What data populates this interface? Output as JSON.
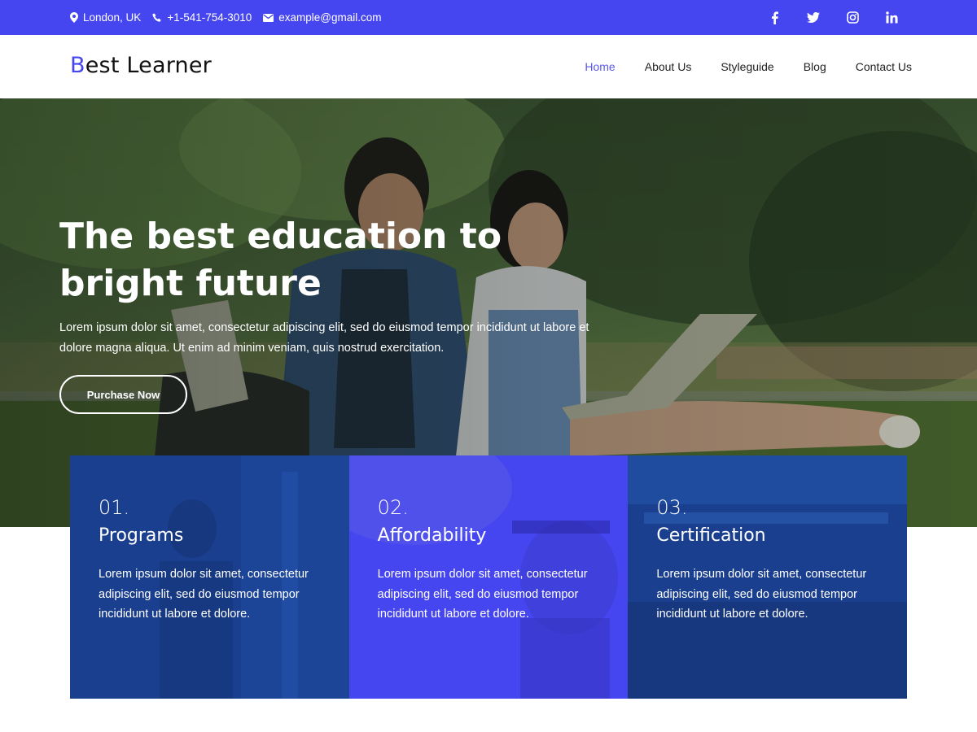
{
  "topbar": {
    "location": "London, UK",
    "phone": "+1-541-754-3010",
    "email": "example@gmail.com",
    "social": [
      "facebook-icon",
      "twitter-icon",
      "instagram-icon",
      "linkedin-icon"
    ]
  },
  "header": {
    "logo_first": "B",
    "logo_rest": "est Learner",
    "nav": [
      {
        "label": "Home",
        "active": true
      },
      {
        "label": "About Us",
        "active": false
      },
      {
        "label": "Styleguide",
        "active": false
      },
      {
        "label": "Blog",
        "active": false
      },
      {
        "label": "Contact Us",
        "active": false
      }
    ]
  },
  "hero": {
    "title": "The best education to bright future",
    "text": "Lorem ipsum dolor sit amet, consectetur adipiscing elit, sed do eiusmod tempor incididunt ut labore et dolore magna aliqua. Ut enim ad minim veniam, quis nostrud exercitation.",
    "button": "Purchase Now"
  },
  "cards": [
    {
      "num": "01.",
      "title": "Programs",
      "text": "Lorem ipsum dolor sit amet, consectetur adipiscing elit, sed do eiusmod tempor incididunt ut labore et dolore.",
      "color": "#1b3f8f"
    },
    {
      "num": "02.",
      "title": "Affordability",
      "text": "Lorem ipsum dolor sit amet, consectetur adipiscing elit, sed do eiusmod tempor incididunt ut labore et dolore.",
      "color": "#4646f0"
    },
    {
      "num": "03.",
      "title": "Certification",
      "text": "Lorem ipsum dolor sit amet, consectetur adipiscing elit, sed do eiusmod tempor incididunt ut labore et dolore.",
      "color": "#1b3f8f"
    }
  ],
  "colors": {
    "accent": "#4646f0",
    "card_dark": "#1b3f8f"
  }
}
